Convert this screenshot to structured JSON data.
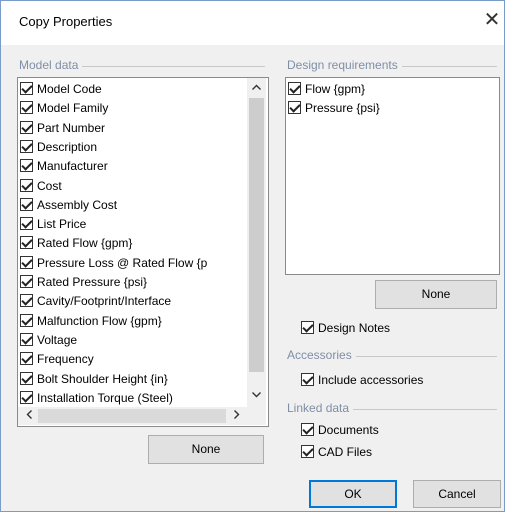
{
  "window": {
    "title": "Copy Properties",
    "close_glyph": "✕"
  },
  "model_data": {
    "label": "Model data",
    "items": [
      {
        "label": "Model Code",
        "checked": true
      },
      {
        "label": "Model Family",
        "checked": true
      },
      {
        "label": "Part Number",
        "checked": true
      },
      {
        "label": "Description",
        "checked": true
      },
      {
        "label": "Manufacturer",
        "checked": true
      },
      {
        "label": "Cost",
        "checked": true
      },
      {
        "label": "Assembly Cost",
        "checked": true
      },
      {
        "label": "List Price",
        "checked": true
      },
      {
        "label": "Rated Flow {gpm}",
        "checked": true
      },
      {
        "label": "Pressure Loss @ Rated Flow {p",
        "checked": true
      },
      {
        "label": "Rated Pressure {psi}",
        "checked": true
      },
      {
        "label": "Cavity/Footprint/Interface",
        "checked": true
      },
      {
        "label": "Malfunction Flow {gpm}",
        "checked": true
      },
      {
        "label": "Voltage",
        "checked": true
      },
      {
        "label": "Frequency",
        "checked": true
      },
      {
        "label": "Bolt Shoulder Height {in}",
        "checked": true
      },
      {
        "label": "Installation Torque (Steel)",
        "checked": true
      }
    ],
    "none_button": "None"
  },
  "design_requirements": {
    "label": "Design requirements",
    "items": [
      {
        "label": "Flow {gpm}",
        "checked": true
      },
      {
        "label": "Pressure {psi}",
        "checked": true
      }
    ],
    "none_button": "None"
  },
  "design_notes": {
    "label": "Design Notes",
    "checked": true
  },
  "accessories": {
    "label": "Accessories",
    "include": {
      "label": "Include accessories",
      "checked": true
    }
  },
  "linked_data": {
    "label": "Linked data",
    "documents": {
      "label": "Documents",
      "checked": true
    },
    "cad_files": {
      "label": "CAD Files",
      "checked": true
    }
  },
  "buttons": {
    "ok": "OK",
    "cancel": "Cancel"
  },
  "icons": {
    "scroll_up": "chevron-up-icon",
    "scroll_down": "chevron-down-icon",
    "scroll_left": "chevron-left-icon",
    "scroll_right": "chevron-right-icon",
    "accent": "#0078d7"
  }
}
